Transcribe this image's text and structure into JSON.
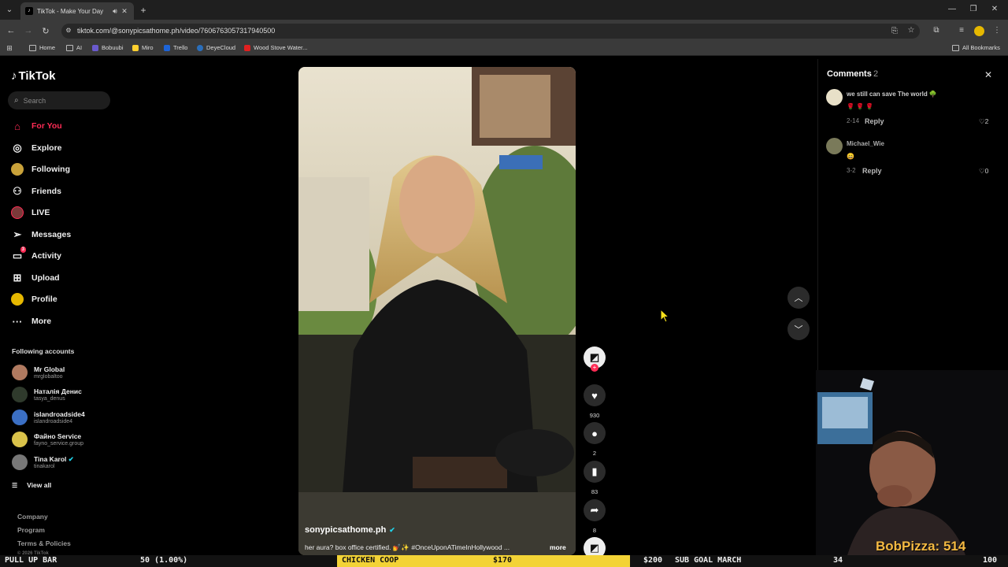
{
  "browser": {
    "tab_title": "TikTok - Make Your Day",
    "url": "tiktok.com/@sonypicsathome.ph/video/7606763057317940500",
    "bookmarks": [
      "Home",
      "AI",
      "Bobuubi",
      "Miro",
      "Trello",
      "DeyeCloud",
      "Wood Stove Water..."
    ],
    "all_bookmarks": "All Bookmarks"
  },
  "tiktok": {
    "logo": "TikTok",
    "search_placeholder": "Search",
    "nav": [
      {
        "label": "For You",
        "icon": "home-icon",
        "active": true
      },
      {
        "label": "Explore",
        "icon": "compass-icon"
      },
      {
        "label": "Following",
        "icon": "following-avatar-icon"
      },
      {
        "label": "Friends",
        "icon": "friends-icon"
      },
      {
        "label": "LIVE",
        "icon": "live-icon"
      },
      {
        "label": "Messages",
        "icon": "messages-icon"
      },
      {
        "label": "Activity",
        "icon": "activity-icon",
        "badge": "3"
      },
      {
        "label": "Upload",
        "icon": "upload-icon"
      },
      {
        "label": "Profile",
        "icon": "profile-icon"
      },
      {
        "label": "More",
        "icon": "more-icon"
      }
    ],
    "following_header": "Following accounts",
    "accounts": [
      {
        "name": "Mr Global",
        "handle": "mrglobaltoo"
      },
      {
        "name": "Наталія Денис",
        "handle": "tasya_denus"
      },
      {
        "name": "islandroadside4",
        "handle": "islandroadside4"
      },
      {
        "name": "Файно Service",
        "handle": "fayno_service.group"
      },
      {
        "name": "Tina Karol",
        "handle": "tinakarol",
        "verified": true
      }
    ],
    "view_all": "View all",
    "footer": [
      "Company",
      "Program",
      "Terms & Policies",
      "© 2026 TikTok"
    ]
  },
  "video": {
    "username": "sonypicsathome.ph",
    "description": "her aura? box office certified. 💅✨ #OnceUponATimeInHollywood ...",
    "more": "more",
    "likes": "930",
    "comments": "2",
    "saves": "83",
    "shares": "8"
  },
  "comments": {
    "title": "Comments",
    "count": "2",
    "items": [
      {
        "text": "we still can save The world 🌳",
        "emoji": "🌹 🌹 🌹",
        "date": "2-14",
        "reply": "Reply",
        "likes": "2"
      },
      {
        "user": "Michael_Wie",
        "emoji": "😄",
        "date": "3-2",
        "reply": "Reply",
        "likes": "0"
      }
    ]
  },
  "stream": {
    "overlay_name": "BobPizza: 514",
    "ticker": [
      "PULL UP BAR",
      "50 (1.00%)",
      "CHICKEN COOP",
      "$170",
      "$200",
      "SUB GOAL MARCH",
      "34",
      "100"
    ]
  }
}
